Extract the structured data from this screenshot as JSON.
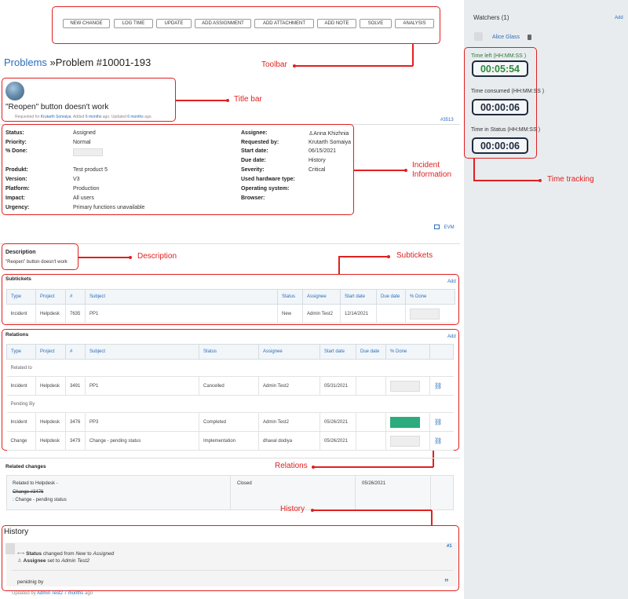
{
  "toolbar": {
    "buttons": [
      "NEW CHANGE",
      "LOG TIME",
      "UPDATE",
      "ADD ASSIGNMENT",
      "ADD ATTACHMENT",
      "ADD NOTE",
      "SOLVE",
      "ANALYSIS"
    ]
  },
  "callouts": {
    "toolbar": "Toolbar",
    "title_bar": "Title bar",
    "incident_information": "Incident\nInformation",
    "description": "Description",
    "subtickets": "Subtickets",
    "relations": "Relations",
    "history": "History",
    "time_tracking": "Time tracking"
  },
  "breadcrumb": {
    "section": "Problems",
    "separator": "»",
    "title": "Problem #10001-193"
  },
  "title_bar": {
    "heading": "\"Reopen\" button doesn't work",
    "meta_prefix": "Requested for",
    "requester": "Krutarth Somaiya",
    "added_prefix": ". Added",
    "added_ago": "6 months",
    "updated_prefix": "ago. Updated",
    "updated_ago": "6 months",
    "suffix": "ago.",
    "ticket_ref": "#3513"
  },
  "info": {
    "left": [
      {
        "label": "Status:",
        "value": "Assigned"
      },
      {
        "label": "Priority:",
        "value": "Normal"
      },
      {
        "label": "% Done:",
        "value": ""
      },
      {
        "label": "Produkt:",
        "value": "Test product 5"
      },
      {
        "label": "Version:",
        "value": "V3"
      },
      {
        "label": "Platform:",
        "value": "Production"
      },
      {
        "label": "Impact:",
        "value": "All users"
      },
      {
        "label": "Urgency:",
        "value": "Primary functions unavailable"
      }
    ],
    "right": [
      {
        "label": "Assignee:",
        "value": "Anna Khizhnia"
      },
      {
        "label": "Requested by:",
        "value": "Krutarth Somaiya"
      },
      {
        "label": "Start date:",
        "value": "06/15/2021"
      },
      {
        "label": "Due date:",
        "value": "History"
      },
      {
        "label": "Severity:",
        "value": "Critical"
      },
      {
        "label": "Used hardware type:",
        "value": ""
      },
      {
        "label": "Operating system:",
        "value": ""
      },
      {
        "label": "Browser:",
        "value": ""
      }
    ],
    "done_percent": 0,
    "evm_label": "EVM"
  },
  "description": {
    "title": "Description",
    "text": "\"Reopen\" button doesn't work"
  },
  "subtickets": {
    "title": "Subtickets",
    "add_label": "Add",
    "columns": [
      "Type",
      "Project",
      "#",
      "Subject",
      "Status",
      "Assignee",
      "Start date",
      "Due date",
      "% Done"
    ],
    "rows": [
      {
        "type": "Incident",
        "project": "Helpdesk",
        "id": "7635",
        "subject": "PP1",
        "status": "New",
        "assignee": "Admin Test2",
        "start": "12/14/2021",
        "due": "",
        "done": 0
      }
    ]
  },
  "relations": {
    "title": "Relations",
    "add_label": "Add",
    "columns": [
      "Type",
      "Project",
      "#",
      "Subject",
      "Status",
      "Assignee",
      "Start date",
      "Due date",
      "% Done"
    ],
    "groups": [
      {
        "name": "Related to",
        "rows": [
          {
            "type": "Incident",
            "project": "Helpdesk",
            "id": "3491",
            "subject": "PP1",
            "status": "Cancelled",
            "assignee": "Admin Test2",
            "start": "05/31/2021",
            "due": "",
            "done": 0
          }
        ]
      },
      {
        "name": "Pending By",
        "rows": [
          {
            "type": "Incident",
            "project": "Helpdesk",
            "id": "3476",
            "subject": "PP3",
            "status": "Completed",
            "assignee": "Admin Test2",
            "start": "05/26/2021",
            "due": "",
            "done": 100
          },
          {
            "type": "Change",
            "project": "Helpdesk",
            "id": "3479",
            "subject": "Change - pending status",
            "status": "Implementation",
            "assignee": "dhaval dodiya",
            "start": "05/26/2021",
            "due": "",
            "done": 0
          }
        ]
      }
    ]
  },
  "related_changes": {
    "title": "Related changes",
    "line1": "Related to Helpdesk -",
    "line2": "Change #3476",
    "line3": ": Change - pending status",
    "status": "Closed",
    "date": "05/26/2021"
  },
  "history": {
    "title": "History",
    "entry_num": "#1",
    "change1_field": "Status",
    "change1_text": "changed from",
    "change1_from": "New",
    "change1_to_word": "to",
    "change1_to": "Assigned",
    "change2_field": "Assignee",
    "change2_text": "set to",
    "change2_value": "Admin Test2",
    "note": "penidnig by",
    "quote": "”",
    "footer_prefix": "Updated by",
    "footer_user": "Admin Test2",
    "footer_ago": "7 months",
    "footer_suffix": "ago"
  },
  "sidebar": {
    "watchers_title": "Watchers (1)",
    "add_label": "Add",
    "watcher": "Alice Glass",
    "time_left_label": "Time left (HH:MM:SS )",
    "time_left": "00:05:54",
    "time_consumed_label": "Time consumed (HH:MM:SS )",
    "time_consumed": "00:00:06",
    "time_status_label": "Time in Status (HH:MM:SS )",
    "time_status": "00:00:06"
  },
  "colors": {
    "accent": "#2a6ebb",
    "callout": "#e02020",
    "progress": "#2bab7e",
    "timer_green": "#2d8a3a"
  }
}
